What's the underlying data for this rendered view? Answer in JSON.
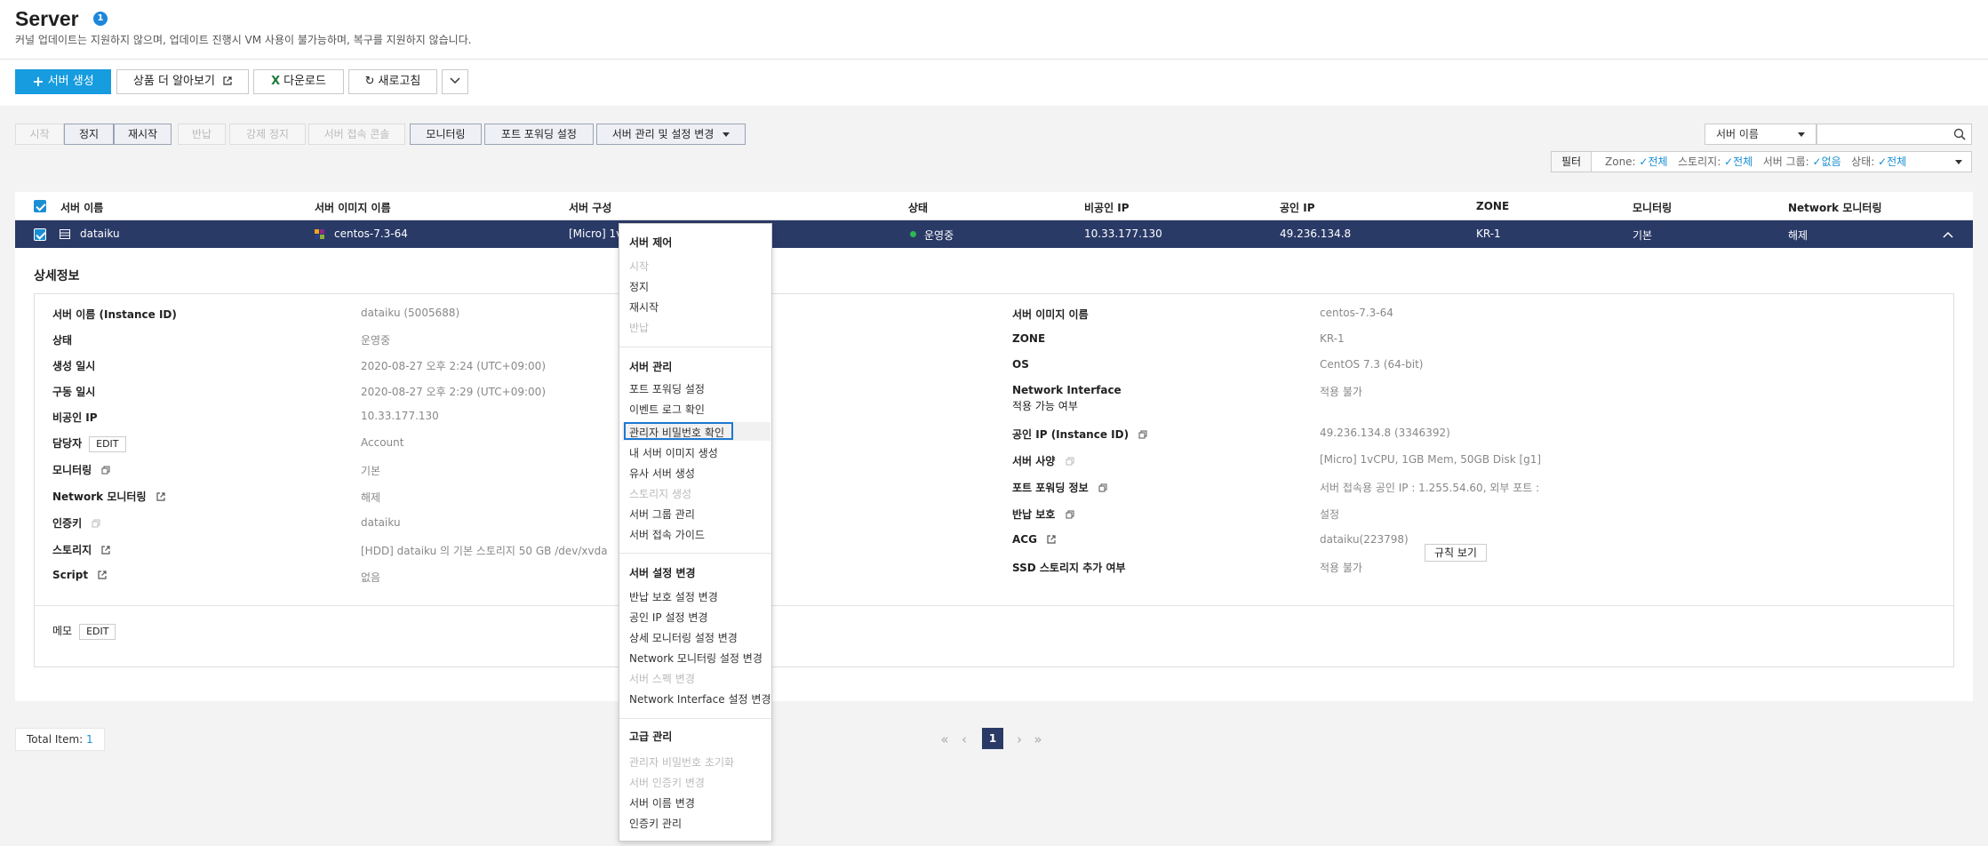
{
  "header": {
    "title": "Server",
    "badge": "1",
    "subtitle": "커널 업데이트는 지원하지 않으며, 업데이트 진행시 VM 사용이 불가능하며, 복구를 지원하지 않습니다."
  },
  "toolbar": {
    "create": "서버 생성",
    "learn_more": "상품 더 알아보기",
    "download": "다운로드",
    "refresh": "새로고침"
  },
  "actions": {
    "start": "시작",
    "stop": "정지",
    "restart": "재시작",
    "return": "반납",
    "force_stop": "강제 정지",
    "console": "서버 접속 콘솔",
    "monitoring": "모니터링",
    "port_forwarding": "포트 포워딩 설정",
    "manage": "서버 관리 및 설정 변경"
  },
  "search": {
    "select_value": "서버 이름",
    "input_value": ""
  },
  "filter": {
    "label": "필터",
    "zone_label": "Zone:",
    "zone_value": "전체",
    "storage_label": "스토리지:",
    "storage_value": "전체",
    "group_label": "서버 그룹:",
    "group_value": "없음",
    "status_label": "상태:",
    "status_value": "전체"
  },
  "table": {
    "columns": [
      "서버 이름",
      "서버 이미지 이름",
      "서버 구성",
      "상태",
      "비공인 IP",
      "공인 IP",
      "ZONE",
      "모니터링",
      "Network 모니터링"
    ],
    "row": {
      "name": "dataiku",
      "image": "centos-7.3-64",
      "spec": "[Micro] 1v",
      "status": "운영중",
      "private_ip": "10.33.177.130",
      "public_ip": "49.236.134.8",
      "zone": "KR-1",
      "monitoring": "기본",
      "net_monitoring": "해제"
    }
  },
  "detail": {
    "title": "상세정보",
    "left": [
      {
        "label": "서버 이름 (Instance ID)",
        "value": "dataiku (5005688)"
      },
      {
        "label": "상태",
        "value": "운영중"
      },
      {
        "label": "생성 일시",
        "value": "2020-08-27 오후 2:24 (UTC+09:00)"
      },
      {
        "label": "구동 일시",
        "value": "2020-08-27 오후 2:29 (UTC+09:00)"
      },
      {
        "label": "비공인 IP",
        "value": "10.33.177.130"
      },
      {
        "label": "담당자",
        "value": "Account"
      },
      {
        "label": "모니터링",
        "value": "기본"
      },
      {
        "label": "Network 모니터링",
        "value": "해제"
      },
      {
        "label": "인증키",
        "value": "dataiku"
      },
      {
        "label": "스토리지",
        "value": "[HDD] dataiku 의 기본 스토리지  50 GB /dev/xvda"
      },
      {
        "label": "Script",
        "value": "없음"
      }
    ],
    "right": [
      {
        "label": "서버 이미지 이름",
        "value": "centos-7.3-64"
      },
      {
        "label": "ZONE",
        "value": "KR-1"
      },
      {
        "label": "OS",
        "value": "CentOS 7.3 (64-bit)"
      },
      {
        "label": "Network Interface",
        "label2": "적용 가능 여부",
        "value": "적용 불가"
      },
      {
        "label": "공인 IP (Instance ID)",
        "value": "49.236.134.8 (3346392)"
      },
      {
        "label": "서버 사양",
        "value": "[Micro] 1vCPU, 1GB Mem, 50GB Disk [g1]"
      },
      {
        "label": "포트 포워딩 정보",
        "value": "서버 접속용 공인 IP : 1.255.54.60, 외부 포트 :"
      },
      {
        "label": "반납 보호",
        "value": "설정"
      },
      {
        "label": "ACG",
        "value": "dataiku(223798)"
      },
      {
        "label": "SSD 스토리지 추가 여부",
        "value": "적용 불가"
      }
    ],
    "edit_label": "EDIT",
    "rule_button": "규칙 보기",
    "memo_label": "메모"
  },
  "menu": {
    "sections": [
      {
        "title": "서버 제어",
        "items": [
          {
            "label": "시작",
            "disabled": true
          },
          {
            "label": "정지",
            "disabled": false
          },
          {
            "label": "재시작",
            "disabled": false
          },
          {
            "label": "반납",
            "disabled": true
          }
        ]
      },
      {
        "title": "서버 관리",
        "items": [
          {
            "label": "포트 포워딩 설정",
            "disabled": false
          },
          {
            "label": "이벤트 로그 확인",
            "disabled": false
          },
          {
            "label": "관리자 비밀번호 확인",
            "disabled": false
          },
          {
            "label": "내 서버 이미지 생성",
            "disabled": false
          },
          {
            "label": "유사 서버 생성",
            "disabled": false
          },
          {
            "label": "스토리지 생성",
            "disabled": true
          },
          {
            "label": "서버 그룹 관리",
            "disabled": false
          },
          {
            "label": "서버 접속 가이드",
            "disabled": false
          }
        ]
      },
      {
        "title": "서버 설정 변경",
        "items": [
          {
            "label": "반납 보호 설정 변경",
            "disabled": false
          },
          {
            "label": "공인 IP 설정 변경",
            "disabled": false
          },
          {
            "label": "상세 모니터링 설정 변경",
            "disabled": false
          },
          {
            "label": "Network 모니터링 설정 변경",
            "disabled": false
          },
          {
            "label": "서버 스펙 변경",
            "disabled": true
          },
          {
            "label": "Network Interface 설정 변경",
            "disabled": false
          }
        ]
      },
      {
        "title": "고급 관리",
        "items": [
          {
            "label": "관리자 비밀번호 초기화",
            "disabled": true
          },
          {
            "label": "서버 인증키 변경",
            "disabled": true
          },
          {
            "label": "서버 이름 변경",
            "disabled": false
          },
          {
            "label": "인증키 관리",
            "disabled": false
          }
        ]
      }
    ]
  },
  "footer": {
    "total_label": "Total Item:",
    "total_value": "1",
    "current_page": "1"
  },
  "colors": {
    "primary": "#169cdf",
    "selected_row": "#2a3a67",
    "status_running": "#2db74f",
    "menu_focus": "#1f78d1"
  },
  "icons": {
    "create": "plus-icon",
    "learn_more": "external-link-icon",
    "download": "excel-icon",
    "refresh": "refresh-icon",
    "expand": "chevron-up-icon"
  }
}
